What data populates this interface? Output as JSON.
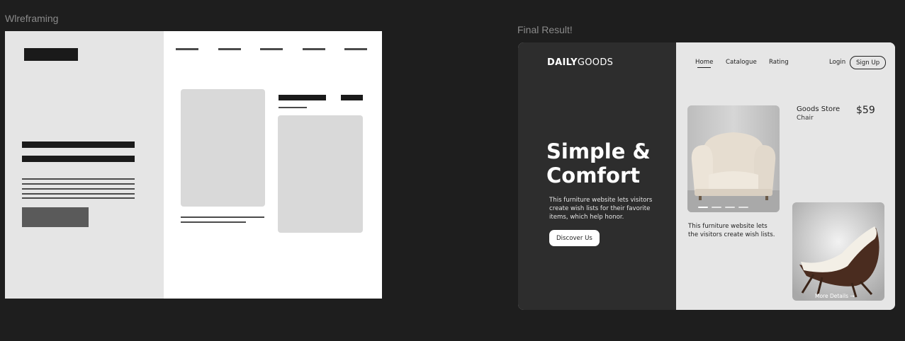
{
  "labels": {
    "wireframe": "Wlreframing",
    "final": "Final Result!"
  },
  "site": {
    "logo_bold": "DAILY",
    "logo_thin": "GOODS",
    "nav": [
      "Home",
      "Catalogue",
      "Rating"
    ],
    "login": "Login",
    "signup": "Sign Up",
    "hero_title_line1": "Simple &",
    "hero_title_line2": "Comfort",
    "hero_desc": "This furniture website lets visitors create wish lists for their favorite items, which help honor.",
    "cta": "Discover Us",
    "product_name": "Goods Store",
    "product_sub": "Chair",
    "price": "$59",
    "card_desc": "This furniture website lets the visitors create wish lists.",
    "more_details": "More Details →"
  },
  "icons": [
    "armchair-image",
    "lounge-chair-image"
  ],
  "colors": {
    "background": "#1e1e1e",
    "dark_panel": "#2d2d2d",
    "light_panel": "#e6e6e6"
  }
}
